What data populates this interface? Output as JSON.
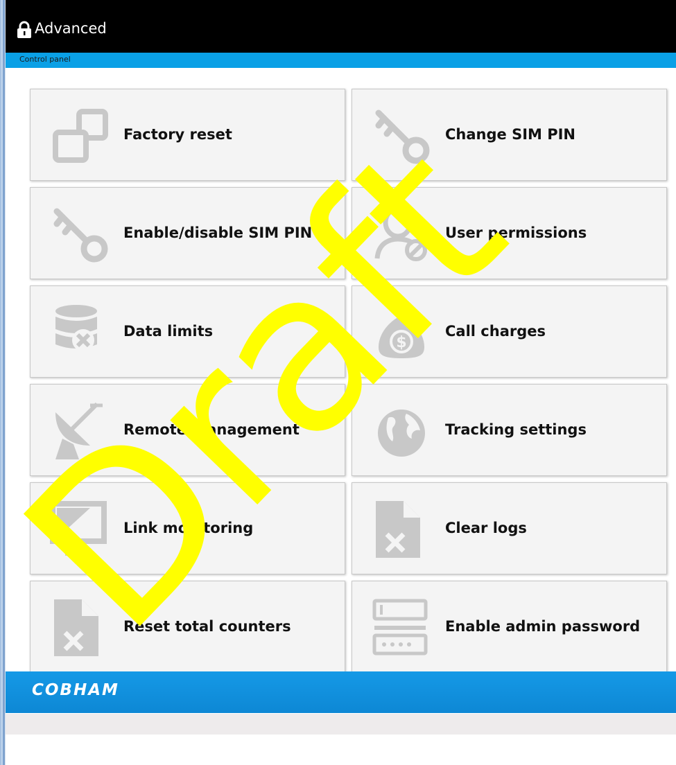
{
  "header": {
    "title": "Advanced",
    "lock_icon": "lock-icon"
  },
  "subbar": {
    "label": "Control panel"
  },
  "tiles": [
    {
      "label": "Factory reset",
      "icon": "windows-icon"
    },
    {
      "label": "Change SIM PIN",
      "icon": "key-icon"
    },
    {
      "label": "Enable/disable SIM PIN",
      "icon": "key-icon"
    },
    {
      "label": "User permissions",
      "icon": "user-blocked-icon"
    },
    {
      "label": "Data limits",
      "icon": "database-x-icon"
    },
    {
      "label": "Call charges",
      "icon": "money-bag-icon"
    },
    {
      "label": "Remote management",
      "icon": "satellite-dish-icon"
    },
    {
      "label": "Tracking settings",
      "icon": "globe-icon"
    },
    {
      "label": "Link monitoring",
      "icon": "monitor-icon"
    },
    {
      "label": "Clear logs",
      "icon": "file-x-icon"
    },
    {
      "label": "Reset total counters",
      "icon": "file-x-icon"
    },
    {
      "label": "Enable admin password",
      "icon": "password-form-icon"
    }
  ],
  "footer": {
    "brand": "COBHAM"
  },
  "watermark": {
    "text": "Draft",
    "color": "#ffff00"
  },
  "colors": {
    "accent": "#0aa0e6",
    "icon_gray": "#c8c8c8",
    "tile_bg": "#f4f4f4"
  }
}
